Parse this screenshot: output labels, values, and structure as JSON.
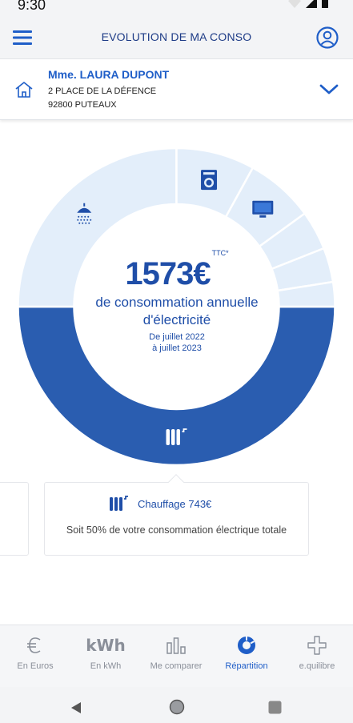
{
  "status": {
    "time": "9:30"
  },
  "header": {
    "title": "EVOLUTION DE MA CONSO",
    "menu_icon": "menu-icon",
    "account_icon": "account-icon"
  },
  "address": {
    "name": "Mme. LAURA DUPONT",
    "line1": "2 PLACE DE LA DÉFENCE",
    "line2": "92800 PUTEAUX",
    "icon": "home-icon"
  },
  "summary": {
    "amount": "1573€",
    "amount_suffix": "TTC*",
    "description": "de consommation annuelle d'électricité",
    "period": "De juillet 2022",
    "period2": "à juillet 2023"
  },
  "segments": [
    {
      "name": "chauffage",
      "icon": "radiator-icon",
      "percent": 50,
      "color": "#2a5db0"
    },
    {
      "name": "eau-chaude",
      "icon": "shower-icon",
      "percent": 25,
      "color": "#e3eefa"
    },
    {
      "name": "lavage",
      "icon": "washing-machine-icon",
      "percent": 8,
      "color": "#e3eefa"
    },
    {
      "name": "multimedia",
      "icon": "tv-icon",
      "percent": 7,
      "color": "#e3eefa"
    },
    {
      "name": "segment-5",
      "icon": "",
      "percent": 4,
      "color": "#e3eefa"
    },
    {
      "name": "segment-6",
      "icon": "",
      "percent": 3.5,
      "color": "#e3eefa"
    },
    {
      "name": "segment-7",
      "icon": "",
      "percent": 2.5,
      "color": "#e3eefa"
    }
  ],
  "card": {
    "icon": "radiator-icon",
    "title": "Chauffage 743€",
    "text": "Soit 50% de votre consommation électrique totale"
  },
  "nav": {
    "items": [
      {
        "label": "En Euros",
        "icon": "euro-icon"
      },
      {
        "label": "En kWh",
        "icon": "kwh-icon",
        "glyph": "kWh"
      },
      {
        "label": "Me comparer",
        "icon": "bar-chart-icon"
      },
      {
        "label": "Répartition",
        "icon": "donut-icon",
        "active": true
      },
      {
        "label": "e.quilibre",
        "icon": "plus-icon"
      }
    ]
  },
  "colors": {
    "primary": "#1f5ec8",
    "dark_blue": "#2a5db0",
    "light_blue": "#e3eefa",
    "muted": "#8a8f99"
  }
}
